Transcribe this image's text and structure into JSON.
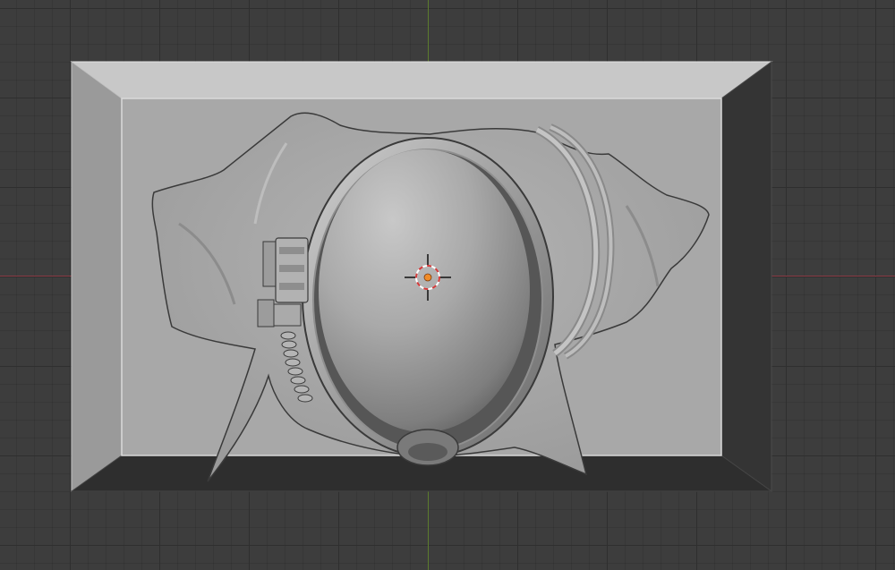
{
  "viewport": {
    "kind": "3d-viewport",
    "background": "#3d3d3d",
    "grid_color": "#2f2f2f",
    "x_axis_color": "#8a3c45",
    "y_axis_color": "#5c7c2e"
  },
  "object": {
    "description_icon": "relief-plaque-mesh",
    "base_color": "#a8a8a8",
    "frame_light": "#c6c6c6",
    "frame_dark": "#333333"
  },
  "cursor_3d": {
    "icon": "3d-cursor-icon",
    "ring_colors": [
      "#d23a3a",
      "#ffffff"
    ],
    "center_color": "#f08c28"
  }
}
